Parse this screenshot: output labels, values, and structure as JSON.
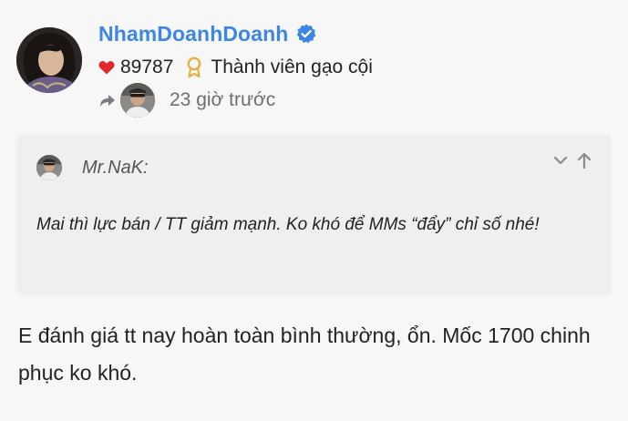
{
  "post": {
    "username": "NhamDoanhDoanh",
    "likes": "89787",
    "title": "Thành viên gạo cội",
    "timestamp": "23 giờ trước",
    "body": "E đánh giá tt nay hoàn toàn bình thường, ổn. Mốc 1700 chinh phục ko khó."
  },
  "quote": {
    "author": "Mr.NaK:",
    "text": "Mai thì lực bán / TT giảm mạnh. Ko khó để MMs “đẩy” chỉ số nhé!"
  },
  "icons": {
    "verified": "verified-badge-icon",
    "heart": "heart-icon",
    "badge": "award-icon",
    "reply": "reply-arrow-icon",
    "expand": "chevron-down-icon",
    "jump": "arrow-up-icon"
  },
  "colors": {
    "username": "#3e86e6",
    "heart": "#e0282e",
    "badge": "#e3b341",
    "muted": "#6e6e73",
    "background": "#f7f7f8",
    "quote_background": "#efeff1"
  }
}
